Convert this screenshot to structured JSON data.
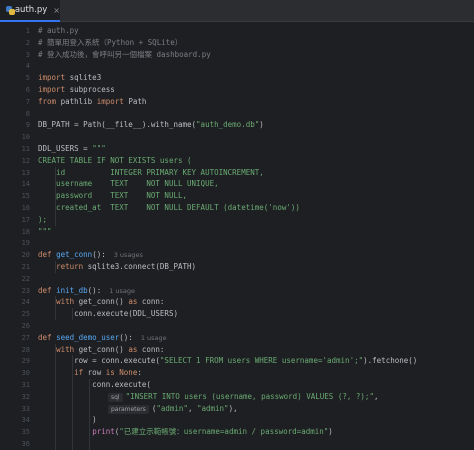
{
  "tab": {
    "filename": "auth.py",
    "close": "×"
  },
  "lines": [
    {
      "n": "1",
      "tokens": [
        {
          "t": "# auth.py",
          "c": "c"
        }
      ]
    },
    {
      "n": "2",
      "tokens": [
        {
          "t": "# 簡單用登入系統（Python + SQLite）",
          "c": "c"
        }
      ]
    },
    {
      "n": "3",
      "tokens": [
        {
          "t": "# 登入成功後，會呼叫另一個檔案 dashboard.py",
          "c": "c"
        }
      ]
    },
    {
      "n": "4",
      "tokens": []
    },
    {
      "n": "5",
      "tokens": [
        {
          "t": "import ",
          "c": "k"
        },
        {
          "t": "sqlite3",
          "c": ""
        }
      ]
    },
    {
      "n": "6",
      "tokens": [
        {
          "t": "import ",
          "c": "k"
        },
        {
          "t": "subprocess",
          "c": ""
        }
      ]
    },
    {
      "n": "7",
      "tokens": [
        {
          "t": "from ",
          "c": "k"
        },
        {
          "t": "pathlib ",
          "c": ""
        },
        {
          "t": "import ",
          "c": "k"
        },
        {
          "t": "Path",
          "c": ""
        }
      ]
    },
    {
      "n": "8",
      "tokens": []
    },
    {
      "n": "9",
      "tokens": [
        {
          "t": "DB_PATH = Path(__file__).with_name(",
          "c": ""
        },
        {
          "t": "\"auth_demo.db\"",
          "c": "s"
        },
        {
          "t": ")",
          "c": ""
        }
      ]
    },
    {
      "n": "10",
      "tokens": []
    },
    {
      "n": "11",
      "tokens": [
        {
          "t": "DDL_USERS = ",
          "c": ""
        },
        {
          "t": "\"\"\"",
          "c": "s"
        }
      ]
    },
    {
      "n": "12",
      "tokens": [
        {
          "t": "CREATE TABLE IF NOT EXISTS users (",
          "c": "s"
        }
      ]
    },
    {
      "n": "13",
      "tokens": [
        {
          "t": "    id          INTEGER PRIMARY KEY AUTOINCREMENT,",
          "c": "s"
        }
      ]
    },
    {
      "n": "14",
      "tokens": [
        {
          "t": "    username    TEXT    NOT NULL UNIQUE,",
          "c": "s"
        }
      ]
    },
    {
      "n": "15",
      "tokens": [
        {
          "t": "    password    TEXT    NOT NULL,",
          "c": "s"
        }
      ]
    },
    {
      "n": "16",
      "tokens": [
        {
          "t": "    created_at  TEXT    NOT NULL DEFAULT (datetime('now'))",
          "c": "s"
        }
      ]
    },
    {
      "n": "17",
      "tokens": [
        {
          "t": ");",
          "c": "s"
        }
      ]
    },
    {
      "n": "18",
      "tokens": [
        {
          "t": "\"\"\"",
          "c": "s"
        }
      ]
    },
    {
      "n": "19",
      "tokens": []
    },
    {
      "n": "20",
      "tokens": [
        {
          "t": "def ",
          "c": "k"
        },
        {
          "t": "get_conn",
          "c": "f"
        },
        {
          "t": "():",
          "c": ""
        }
      ],
      "hint": "3 usages"
    },
    {
      "n": "21",
      "tokens": [
        {
          "t": "    ",
          "c": ""
        },
        {
          "t": "return ",
          "c": "k"
        },
        {
          "t": "sqlite3.connect(DB_PATH)",
          "c": ""
        }
      ]
    },
    {
      "n": "22",
      "tokens": []
    },
    {
      "n": "23",
      "tokens": [
        {
          "t": "def ",
          "c": "k"
        },
        {
          "t": "init_db",
          "c": "f"
        },
        {
          "t": "():",
          "c": ""
        }
      ],
      "hint": "1 usage"
    },
    {
      "n": "24",
      "tokens": [
        {
          "t": "    ",
          "c": ""
        },
        {
          "t": "with ",
          "c": "k"
        },
        {
          "t": "get_conn() ",
          "c": ""
        },
        {
          "t": "as ",
          "c": "k"
        },
        {
          "t": "conn:",
          "c": ""
        }
      ]
    },
    {
      "n": "25",
      "tokens": [
        {
          "t": "        conn.execute(DDL_USERS)",
          "c": ""
        }
      ]
    },
    {
      "n": "26",
      "tokens": []
    },
    {
      "n": "27",
      "tokens": [
        {
          "t": "def ",
          "c": "k"
        },
        {
          "t": "seed_demo_user",
          "c": "f"
        },
        {
          "t": "():",
          "c": ""
        }
      ],
      "hint": "1 usage"
    },
    {
      "n": "28",
      "tokens": [
        {
          "t": "    ",
          "c": ""
        },
        {
          "t": "with ",
          "c": "k"
        },
        {
          "t": "get_conn() ",
          "c": ""
        },
        {
          "t": "as ",
          "c": "k"
        },
        {
          "t": "conn:",
          "c": ""
        }
      ]
    },
    {
      "n": "29",
      "tokens": [
        {
          "t": "        row = conn.execute(",
          "c": ""
        },
        {
          "t": "\"SELECT 1 FROM users WHERE username='admin';\"",
          "c": "s"
        },
        {
          "t": ").fetchone()",
          "c": ""
        }
      ]
    },
    {
      "n": "30",
      "tokens": [
        {
          "t": "        ",
          "c": ""
        },
        {
          "t": "if ",
          "c": "k"
        },
        {
          "t": "row ",
          "c": ""
        },
        {
          "t": "is None",
          "c": "k"
        },
        {
          "t": ":",
          "c": ""
        }
      ]
    },
    {
      "n": "31",
      "tokens": [
        {
          "t": "            conn.execute(",
          "c": ""
        }
      ]
    },
    {
      "n": "32",
      "chip": "sql",
      "tokens": [
        {
          "t": "\"INSERT INTO users (username, password) VALUES (?, ?);\"",
          "c": "s"
        },
        {
          "t": ",",
          "c": ""
        }
      ]
    },
    {
      "n": "33",
      "chip": "parameters",
      "tokens": [
        {
          "t": "(",
          "c": ""
        },
        {
          "t": "\"admin\"",
          "c": "s"
        },
        {
          "t": ", ",
          "c": ""
        },
        {
          "t": "\"admin\"",
          "c": "s"
        },
        {
          "t": "),",
          "c": ""
        }
      ]
    },
    {
      "n": "34",
      "tokens": [
        {
          "t": "            )",
          "c": ""
        }
      ]
    },
    {
      "n": "35",
      "tokens": [
        {
          "t": "            ",
          "c": ""
        },
        {
          "t": "print",
          "c": "n"
        },
        {
          "t": "(",
          "c": ""
        },
        {
          "t": "\"已建立示範帳號：username=admin / password=admin\"",
          "c": "s"
        },
        {
          "t": ")",
          "c": ""
        }
      ]
    },
    {
      "n": "36",
      "tokens": []
    }
  ]
}
